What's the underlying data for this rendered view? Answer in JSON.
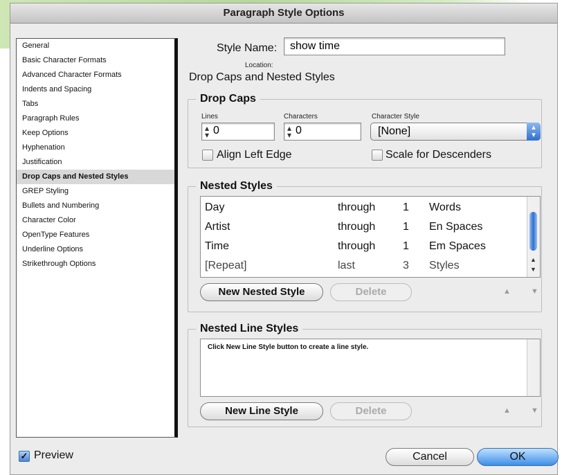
{
  "window": {
    "title": "Paragraph Style Options"
  },
  "sidebar": {
    "items": [
      {
        "label": "General"
      },
      {
        "label": "Basic Character Formats"
      },
      {
        "label": "Advanced Character Formats"
      },
      {
        "label": "Indents and Spacing"
      },
      {
        "label": "Tabs"
      },
      {
        "label": "Paragraph Rules"
      },
      {
        "label": "Keep Options"
      },
      {
        "label": "Hyphenation"
      },
      {
        "label": "Justification"
      },
      {
        "label": "Drop Caps and Nested Styles"
      },
      {
        "label": "GREP Styling"
      },
      {
        "label": "Bullets and Numbering"
      },
      {
        "label": "Character Color"
      },
      {
        "label": "OpenType Features"
      },
      {
        "label": "Underline Options"
      },
      {
        "label": "Strikethrough Options"
      }
    ],
    "selected": "Drop Caps and Nested Styles"
  },
  "header": {
    "style_name_label": "Style Name:",
    "style_name_value": "show time",
    "location_label": "Location:",
    "section_title": "Drop Caps and Nested Styles"
  },
  "drop_caps": {
    "legend": "Drop Caps",
    "lines_label": "Lines",
    "lines_value": "0",
    "characters_label": "Characters",
    "characters_value": "0",
    "char_style_label": "Character Style",
    "char_style_value": "[None]",
    "align_left_edge": "Align Left Edge",
    "scale_descenders": "Scale for Descenders"
  },
  "nested_styles": {
    "legend": "Nested Styles",
    "rows": [
      {
        "style": "Day",
        "mode": "through",
        "count": "1",
        "unit": "Words"
      },
      {
        "style": "Artist",
        "mode": "through",
        "count": "1",
        "unit": "En Spaces"
      },
      {
        "style": "Time",
        "mode": "through",
        "count": "1",
        "unit": "Em Spaces"
      },
      {
        "style": "[Repeat]",
        "mode": "last",
        "count": "3",
        "unit": "Styles"
      }
    ],
    "new_button": "New Nested Style",
    "delete_button": "Delete"
  },
  "nested_line_styles": {
    "legend": "Nested Line Styles",
    "hint": "Click New Line Style button to create a line style.",
    "new_button": "New Line Style",
    "delete_button": "Delete"
  },
  "footer": {
    "preview_label": "Preview",
    "cancel_button": "Cancel",
    "ok_button": "OK"
  },
  "colors": {
    "accent": "#2f6fd0",
    "sidebar_selected": "#d8d8d8"
  }
}
